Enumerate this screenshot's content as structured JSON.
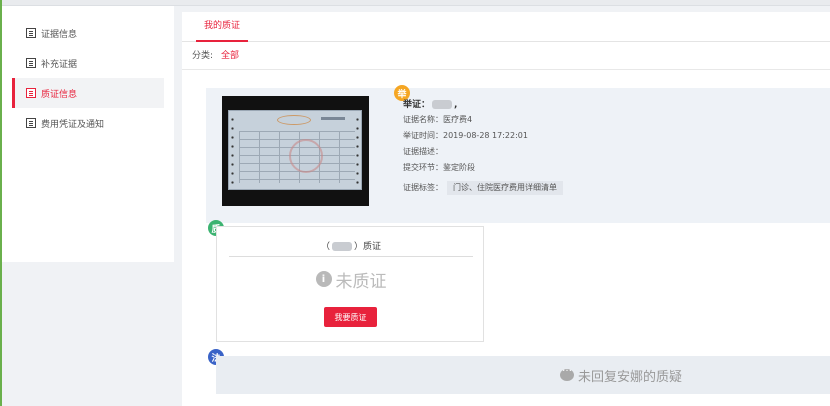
{
  "sidebar": {
    "items": [
      {
        "label": "证据信息",
        "active": false
      },
      {
        "label": "补充证据",
        "active": false
      },
      {
        "label": "质证信息",
        "active": true
      },
      {
        "label": "费用凭证及通知",
        "active": false
      }
    ]
  },
  "tabs": [
    {
      "label": "我的质证",
      "active": true
    }
  ],
  "filter": {
    "label": "分类:",
    "value": "全部"
  },
  "claim": {
    "badge": "举",
    "head_label": "举证：",
    "head_suffix": ",",
    "name_label": "证据名称：",
    "name_value": "医疗费4",
    "time_label": "举证时间：",
    "time_value": "2019-08-28 17:22:01",
    "desc_label": "证据描述：",
    "desc_value": "",
    "stage_label": "提交环节：",
    "stage_value": "鉴定阶段",
    "tags_label": "证据标签：",
    "tag": "门诊、住院医疗费用详细清单"
  },
  "question": {
    "badge": "质",
    "title_open": "（",
    "title_close": "）质证",
    "status_icon": "i",
    "status": "未质证",
    "button": "我要质证"
  },
  "law": {
    "badge": "法",
    "message": "未回复安娜的质疑"
  },
  "colors": {
    "accent": "#e8223c",
    "ju": "#f5a623",
    "zhi": "#3cb371",
    "fa": "#3a63c7"
  }
}
